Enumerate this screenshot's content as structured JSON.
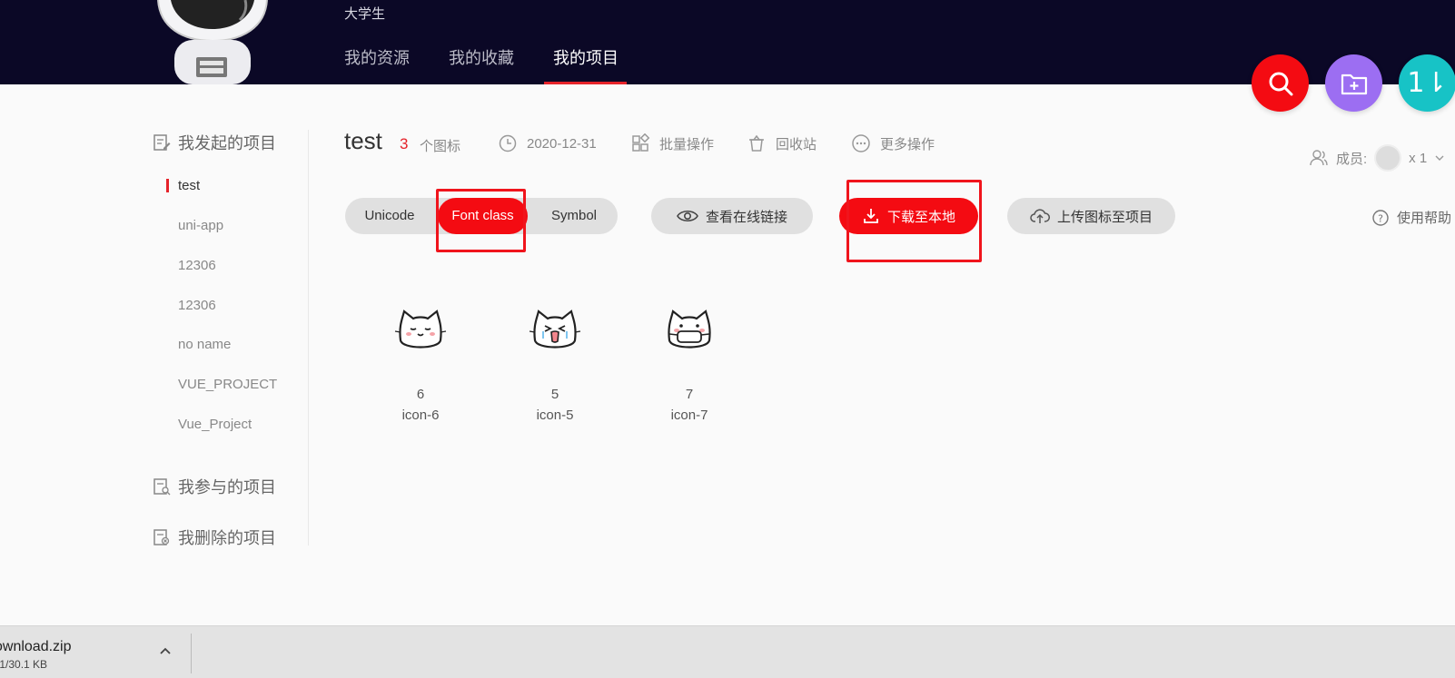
{
  "header": {
    "user_role": "大学生",
    "tabs": [
      {
        "label": "我的资源"
      },
      {
        "label": "我的收藏"
      },
      {
        "label": "我的项目"
      }
    ],
    "active_tab": "我的项目"
  },
  "fabs": {
    "search": {
      "icon": "search-icon",
      "color": "#f40b12"
    },
    "add_folder": {
      "icon": "folder-add-icon",
      "color": "#9c6ef2"
    },
    "sort": {
      "label": "1⇂",
      "color": "#17c3c6"
    }
  },
  "sidebar": {
    "groups": [
      {
        "label": "我发起的项目",
        "icon": "edit-doc-icon"
      },
      {
        "label": "我参与的项目",
        "icon": "search-doc-icon"
      },
      {
        "label": "我删除的项目",
        "icon": "delete-doc-icon"
      }
    ],
    "projects": [
      "test",
      "uni-app",
      "12306",
      "12306",
      "no name",
      "VUE_PROJECT",
      "Vue_Project"
    ],
    "active_project": "test"
  },
  "project": {
    "title": "test",
    "icon_count": "3",
    "icon_count_label": "个图标",
    "date": "2020-12-31",
    "batch_label": "批量操作",
    "recycle_label": "回收站",
    "more_label": "更多操作",
    "members_label": "成员:",
    "members_count": "x 1",
    "help_label": "使用帮助"
  },
  "toolbar": {
    "formats": [
      "Unicode",
      "Font class",
      "Symbol"
    ],
    "active_format": "Font class",
    "view_link_label": "查看在线链接",
    "download_label": "下载至本地",
    "upload_label": "上传图标至项目"
  },
  "icons": [
    {
      "name": "6",
      "class": "icon-6"
    },
    {
      "name": "5",
      "class": "icon-5"
    },
    {
      "name": "7",
      "class": "icon-7"
    }
  ],
  "download_bar": {
    "file_name": "ownload.zip",
    "progress_text": ".1/30.1 KB"
  },
  "colors": {
    "header_bg": "#0b0826",
    "accent": "#f40b12",
    "purple": "#9c6ef2",
    "teal": "#17c3c6"
  }
}
